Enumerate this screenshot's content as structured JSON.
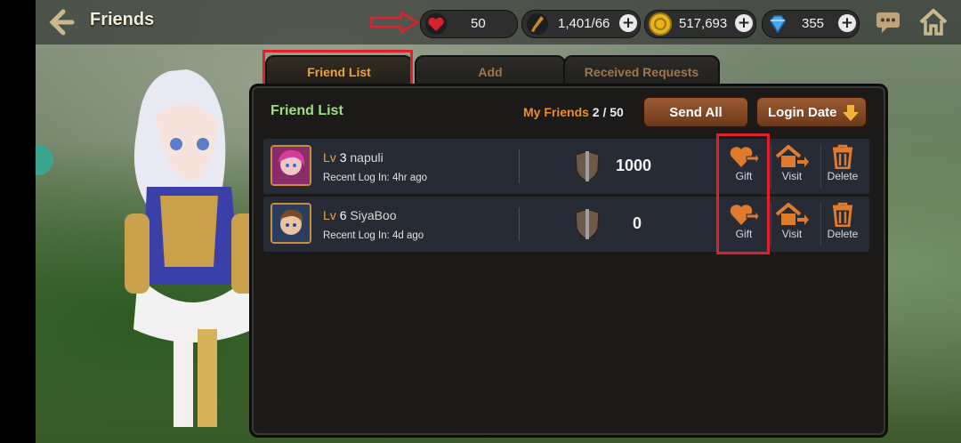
{
  "header": {
    "title": "Friends",
    "resources": [
      {
        "icon": "heart-icon",
        "value": "50"
      },
      {
        "icon": "key-icon",
        "value": "1,401/66"
      },
      {
        "icon": "gold-coin-icon",
        "value": "517,693"
      },
      {
        "icon": "diamond-icon",
        "value": "355"
      }
    ]
  },
  "tabs": [
    {
      "label": "Friend List",
      "active": true
    },
    {
      "label": "Add",
      "active": false
    },
    {
      "label": "Received Requests",
      "active": false
    }
  ],
  "panel": {
    "title": "Friend List",
    "my_friends_label": "My Friends",
    "my_friends_count": "2 / 50",
    "send_all": "Send All",
    "login_date": "Login Date"
  },
  "friends": [
    {
      "lv_label": "Lv",
      "level": "3",
      "name": "napuli",
      "login_label": "Recent Log In: 4hr ago",
      "score": "1000",
      "gift": "Gift",
      "visit": "Visit",
      "delete": "Delete"
    },
    {
      "lv_label": "Lv",
      "level": "6",
      "name": "SiyaBoo",
      "login_label": "Recent Log In: 4d ago",
      "score": "0",
      "gift": "Gift",
      "visit": "Visit",
      "delete": "Delete"
    }
  ],
  "colors": {
    "accent_orange": "#e88f2c",
    "title_green": "#9be07e",
    "annotation_red": "#e0202a"
  }
}
